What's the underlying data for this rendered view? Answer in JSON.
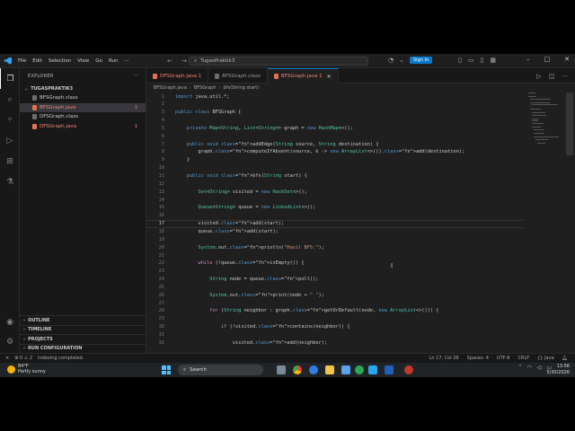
{
  "titlebar": {
    "menu": [
      "File",
      "Edit",
      "Selection",
      "View",
      "Go",
      "Run"
    ],
    "more": "···",
    "nav": "← →",
    "command_center": "TugasPraktik3",
    "signin": "Sign In"
  },
  "sidebar": {
    "header": "EXPLORER",
    "more": "···",
    "project": "TUGASPRAKTIK3",
    "files": [
      {
        "name": "BFSGraph.class",
        "badge": ""
      },
      {
        "name": "BFSGraph.java",
        "badge": "1"
      },
      {
        "name": "DFSGraph.class",
        "badge": ""
      },
      {
        "name": "DFSGraph.java",
        "badge": "1"
      }
    ],
    "sections": [
      "OUTLINE",
      "TIMELINE",
      "PROJECTS",
      "RUN CONFIGURATION"
    ]
  },
  "tabs": [
    {
      "label": "DFSGraph.java 1",
      "close": ""
    },
    {
      "label": "BFSGraph.class",
      "close": ""
    },
    {
      "label": "BFSGraph.java 1",
      "close": "✕"
    }
  ],
  "breadcrumb": [
    "BFSGraph.java",
    "BFSGraph",
    "bfs(String start)"
  ],
  "code": {
    "lines": [
      {
        "n": "1",
        "t": "import java.util.*;"
      },
      {
        "n": "2",
        "t": ""
      },
      {
        "n": "3",
        "t": "public class BFSGraph {"
      },
      {
        "n": "4",
        "t": ""
      },
      {
        "n": "5",
        "t": "    private Map<String, List<String>> graph = new HashMap<>();"
      },
      {
        "n": "6",
        "t": ""
      },
      {
        "n": "7",
        "t": "    public void addEdge(String source, String destination) {"
      },
      {
        "n": "8",
        "t": "        graph.computeIfAbsent(source, k -> new ArrayList<>()).add(destination);"
      },
      {
        "n": "9",
        "t": "    }"
      },
      {
        "n": "10",
        "t": ""
      },
      {
        "n": "11",
        "t": "    public void bfs(String start) {"
      },
      {
        "n": "12",
        "t": ""
      },
      {
        "n": "13",
        "t": "        Set<String> visited = new HashSet<>();"
      },
      {
        "n": "14",
        "t": ""
      },
      {
        "n": "15",
        "t": "        Queue<String> queue = new LinkedList<>();"
      },
      {
        "n": "16",
        "t": ""
      },
      {
        "n": "17",
        "t": "        visited.add(start);"
      },
      {
        "n": "18",
        "t": "        queue.add(start);"
      },
      {
        "n": "19",
        "t": ""
      },
      {
        "n": "20",
        "t": "        System.out.println(\"Hasil BFS:\");"
      },
      {
        "n": "21",
        "t": ""
      },
      {
        "n": "22",
        "t": "        while (!queue.isEmpty()) {"
      },
      {
        "n": "23",
        "t": ""
      },
      {
        "n": "24",
        "t": "            String node = queue.poll();"
      },
      {
        "n": "25",
        "t": ""
      },
      {
        "n": "26",
        "t": "            System.out.print(node + \" \");"
      },
      {
        "n": "27",
        "t": ""
      },
      {
        "n": "28",
        "t": "            for (String neighbor : graph.getOrDefault(node, new ArrayList<>())) {"
      },
      {
        "n": "29",
        "t": ""
      },
      {
        "n": "30",
        "t": "                if (!visited.contains(neighbor)) {"
      },
      {
        "n": "31",
        "t": ""
      },
      {
        "n": "32",
        "t": "                    visited.add(neighbor);"
      }
    ]
  },
  "status": {
    "errors": "⊗ 0 ⚠ 2",
    "indexing": "Indexing completed.",
    "position": "Ln 17, Col 28",
    "spaces": "Spaces: 4",
    "encoding": "UTF-8",
    "eol": "CRLF",
    "language": "{} Java"
  },
  "taskbar": {
    "temp": "84°F",
    "weather": "Partly sunny",
    "search": "Search",
    "time": "13:56",
    "date": "5/30/2026"
  },
  "colors": {
    "accent": "#0078d4",
    "error": "#f48771",
    "keyword": "#569cd6",
    "type": "#4ec9b0"
  }
}
